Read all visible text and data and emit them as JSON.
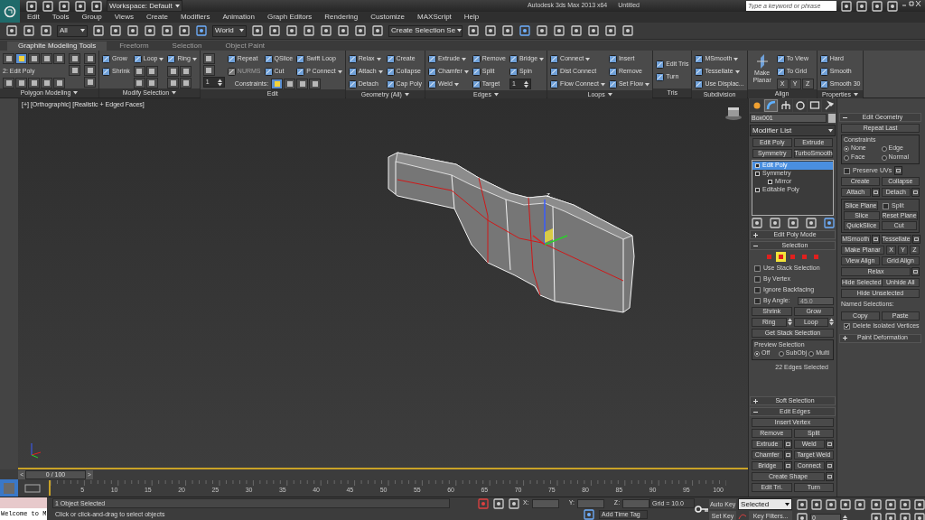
{
  "title_bar": {
    "workspace": "Workspace: Default",
    "title": "Autodesk 3ds Max 2013 x64",
    "document": "Untitled",
    "search": {
      "placeholder": "Type a keyword or phrase"
    }
  },
  "menu": [
    "Edit",
    "Tools",
    "Group",
    "Views",
    "Create",
    "Modifiers",
    "Animation",
    "Graph Editors",
    "Rendering",
    "Customize",
    "MAXScript",
    "Help"
  ],
  "toolbar": {
    "selection_filter": "All",
    "reference_coordinates": "World",
    "named_selection": "Create Selection Se"
  },
  "ribbon_tabs": [
    {
      "label": "Graphite Modeling Tools",
      "selected": true
    },
    {
      "label": "Freeform",
      "selected": false
    },
    {
      "label": "Selection",
      "selected": false
    },
    {
      "label": "Object Paint",
      "selected": false
    }
  ],
  "ribbon_groups": [
    {
      "title": "Polygon Modeling",
      "menu": true,
      "columns": [
        [
          {
            "kind": "subobjects",
            "items": [
              {
                "selected": false
              },
              {
                "selected": true
              },
              {
                "selected": false
              },
              {
                "selected": false
              },
              {
                "selected": false
              }
            ]
          },
          {
            "kind": "caption",
            "label": "2: Edit Poly"
          },
          {
            "kind": "tool-row"
          }
        ],
        [
          {
            "kind": "icon"
          },
          {
            "kind": "icon"
          }
        ],
        [
          {
            "kind": "icon"
          },
          {
            "kind": "icon"
          },
          {
            "kind": "icon"
          }
        ]
      ]
    },
    {
      "title": "Modify Selection",
      "menu": true,
      "columns": [
        [
          {
            "kind": "button",
            "label": "Grow"
          },
          {
            "kind": "button",
            "label": "Shrink"
          }
        ],
        [
          {
            "kind": "menu",
            "label": "Loop"
          },
          {
            "kind": "icon-pair"
          },
          {
            "kind": "icon-pair"
          }
        ],
        [
          {
            "kind": "menu",
            "label": "Ring"
          },
          {
            "kind": "icon-pair"
          },
          {
            "kind": "icon-pair"
          }
        ]
      ]
    },
    {
      "title": "Edit",
      "menu": false,
      "lead": [
        {
          "kind": "icon"
        },
        {
          "kind": "icon"
        },
        {
          "kind": "spinner",
          "value": "1"
        }
      ],
      "columns": [
        [
          {
            "kind": "button",
            "label": "Repeat"
          },
          {
            "kind": "button",
            "label": "NURMS",
            "disabled": true
          }
        ],
        [
          {
            "kind": "button",
            "label": "QSlice"
          },
          {
            "kind": "button",
            "label": "Cut"
          }
        ],
        [
          {
            "kind": "button",
            "label": "Swift Loop"
          },
          {
            "kind": "menu",
            "label": "P Connect"
          }
        ]
      ],
      "footer": {
        "label": "Constraints:",
        "items": [
          {
            "selected": true
          },
          {
            "selected": false
          },
          {
            "selected": false
          },
          {
            "selected": false
          }
        ]
      }
    },
    {
      "title": "Geometry (All)",
      "menu": true,
      "columns": [
        [
          {
            "kind": "menu",
            "label": "Relax"
          },
          {
            "kind": "menu",
            "label": "Attach"
          },
          {
            "kind": "button",
            "label": "Detach"
          }
        ],
        [
          {
            "kind": "button",
            "label": "Create"
          },
          {
            "kind": "button",
            "label": "Collapse"
          },
          {
            "kind": "button",
            "label": "Cap Poly"
          }
        ]
      ]
    },
    {
      "title": "Edges",
      "menu": true,
      "columns": [
        [
          {
            "kind": "menu",
            "label": "Extrude"
          },
          {
            "kind": "menu",
            "label": "Chamfer"
          },
          {
            "kind": "menu",
            "label": "Weld"
          }
        ],
        [
          {
            "kind": "button",
            "label": "Remove"
          },
          {
            "kind": "button",
            "label": "Split"
          },
          {
            "kind": "button",
            "label": "Target"
          }
        ],
        [
          {
            "kind": "menu",
            "label": "Bridge"
          },
          {
            "kind": "button",
            "label": "Spin"
          },
          {
            "kind": "spinner",
            "value": "1"
          }
        ]
      ]
    },
    {
      "title": "Loops",
      "menu": true,
      "columns": [
        [
          {
            "kind": "menu",
            "label": "Connect"
          },
          {
            "kind": "button",
            "label": "Dist Connect"
          },
          {
            "kind": "menu",
            "label": "Flow Connect"
          }
        ],
        [
          {
            "kind": "button",
            "label": "Insert"
          },
          {
            "kind": "button",
            "label": "Remove"
          },
          {
            "kind": "menu",
            "label": "Set  Flow"
          }
        ]
      ]
    },
    {
      "title": "Tris",
      "menu": false,
      "columns": [
        [
          {
            "kind": "button",
            "label": "Edit Tris"
          },
          {
            "kind": "button",
            "label": "Turn"
          }
        ]
      ]
    },
    {
      "title": "Subdivision",
      "menu": false,
      "columns": [
        [
          {
            "kind": "menu",
            "label": "MSmooth"
          },
          {
            "kind": "menu",
            "label": "Tessellate"
          },
          {
            "kind": "button",
            "label": "Use Displac..."
          }
        ]
      ]
    },
    {
      "title": "Align",
      "menu": false,
      "lead": [
        {
          "kind": "large",
          "label": "Make Planar"
        }
      ],
      "columns": [
        [
          {
            "kind": "button",
            "label": "To View"
          },
          {
            "kind": "button",
            "label": "To Grid"
          },
          {
            "kind": "axes",
            "labels": [
              "X",
              "Y",
              "Z"
            ]
          }
        ]
      ]
    },
    {
      "title": "Properties",
      "menu": true,
      "columns": [
        [
          {
            "kind": "button",
            "label": "Hard"
          },
          {
            "kind": "button",
            "label": "Smooth"
          },
          {
            "kind": "button",
            "label": "Smooth 30"
          }
        ]
      ]
    }
  ],
  "viewport": {
    "label": "[+] [Orthographic] [Realistic + Edged Faces]",
    "gizmo_axis": "z"
  },
  "command_panel": {
    "tabs": [
      {
        "kind": "create",
        "selected": false
      },
      {
        "kind": "modify",
        "selected": true
      },
      {
        "kind": "hierarchy",
        "selected": false
      },
      {
        "kind": "motion",
        "selected": false
      },
      {
        "kind": "display",
        "selected": false
      },
      {
        "kind": "utilities",
        "selected": false
      }
    ],
    "object_name": "Box001",
    "modifier_list": "Modifier List",
    "modifier_buttons": [
      "Edit Poly",
      "Extrude",
      "Symmetry",
      "TurboSmooth"
    ],
    "stack": [
      {
        "label": "Edit Poly",
        "selected": true
      },
      {
        "label": "Symmetry",
        "selected": false,
        "children": [
          {
            "label": "Mirror",
            "selected": false
          }
        ]
      },
      {
        "label": "Editable Poly",
        "selected": false
      }
    ],
    "rollouts": [
      {
        "title": "Edit Poly Mode",
        "expanded": false
      },
      {
        "title": "Selection",
        "expanded": true,
        "rows": [
          [
            {
              "kind": "subobjects",
              "items": [
                {
                  "selected": false
                },
                {
                  "selected": true
                },
                {
                  "selected": false
                },
                {
                  "selected": false
                },
                {
                  "selected": false
                }
              ]
            }
          ],
          [
            {
              "kind": "checkbox",
              "label": "Use Stack Selection",
              "checked": false
            }
          ],
          [
            {
              "kind": "checkbox",
              "label": "By Vertex",
              "checked": false
            }
          ],
          [
            {
              "kind": "checkbox",
              "label": "Ignore Backfacing",
              "checked": false
            }
          ],
          [
            {
              "kind": "checkbox",
              "label": "By Angle:",
              "checked": false
            },
            {
              "kind": "field",
              "value": "45.0"
            }
          ],
          [
            {
              "kind": "button",
              "label": "Shrink"
            },
            {
              "kind": "button",
              "label": "Grow"
            }
          ],
          [
            {
              "kind": "button",
              "label": "Ring",
              "spinner": true
            },
            {
              "kind": "button",
              "label": "Loop",
              "spinner": true
            }
          ],
          [
            {
              "kind": "button",
              "label": "Get Stack Selection"
            }
          ],
          [
            {
              "kind": "group",
              "title": "Preview Selection",
              "rows": [
                [
                  {
                    "kind": "radio",
                    "label": "Off",
                    "selected": true
                  },
                  {
                    "kind": "radio",
                    "label": "SubObj",
                    "selected": false
                  },
                  {
                    "kind": "radio",
                    "label": "Multi",
                    "selected": false
                  }
                ]
              ]
            }
          ],
          [
            {
              "kind": "text",
              "label": "22 Edges Selected"
            }
          ],
          [
            {
              "kind": "spacer"
            }
          ]
        ]
      },
      {
        "title": "Soft Selection",
        "expanded": false
      },
      {
        "title": "Edit Edges",
        "expanded": true,
        "rows": [
          [
            {
              "kind": "button",
              "label": "Insert Vertex"
            }
          ],
          [
            {
              "kind": "button",
              "label": "Remove"
            },
            {
              "kind": "button",
              "label": "Split"
            }
          ],
          [
            {
              "kind": "button",
              "label": "Extrude",
              "options": true
            },
            {
              "kind": "button",
              "label": "Weld",
              "options": true
            }
          ],
          [
            {
              "kind": "button",
              "label": "Chamfer",
              "options": true
            },
            {
              "kind": "button",
              "label": "Target Weld"
            }
          ],
          [
            {
              "kind": "button",
              "label": "Bridge",
              "options": true
            },
            {
              "kind": "button",
              "label": "Connect",
              "options": true
            }
          ],
          [
            {
              "kind": "button",
              "label": "Create Shape",
              "options": true
            }
          ],
          [
            {
              "kind": "button",
              "label": "Edit Tri."
            },
            {
              "kind": "button",
              "label": "Turn"
            }
          ]
        ]
      }
    ]
  },
  "geometry_panel": {
    "rollouts": [
      {
        "title": "Edit Geometry",
        "expanded": true,
        "rows": [
          [
            {
              "kind": "button",
              "label": "Repeat Last"
            }
          ],
          [
            {
              "kind": "group",
              "title": "Constraints",
              "rows": [
                [
                  {
                    "kind": "radio",
                    "label": "None",
                    "selected": true
                  },
                  {
                    "kind": "radio",
                    "label": "Edge",
                    "selected": false
                  }
                ],
                [
                  {
                    "kind": "radio",
                    "label": "Face",
                    "selected": false
                  },
                  {
                    "kind": "radio",
                    "label": "Normal",
                    "selected": false
                  }
                ]
              ]
            }
          ],
          [
            {
              "kind": "checkbox",
              "label": "Preserve UVs",
              "checked": false,
              "options": true
            }
          ],
          [
            {
              "kind": "button",
              "label": "Create"
            },
            {
              "kind": "button",
              "label": "Collapse"
            }
          ],
          [
            {
              "kind": "button",
              "label": "Attach",
              "options": true
            },
            {
              "kind": "button",
              "label": "Detach",
              "options": true
            }
          ],
          [
            {
              "kind": "group",
              "rows": [
                [
                  {
                    "kind": "button",
                    "label": "Slice Plane"
                  },
                  {
                    "kind": "checkbox",
                    "label": "Split",
                    "checked": false
                  }
                ],
                [
                  {
                    "kind": "button",
                    "label": "Slice"
                  },
                  {
                    "kind": "button",
                    "label": "Reset Plane"
                  }
                ],
                [
                  {
                    "kind": "button",
                    "label": "QuickSlice"
                  },
                  {
                    "kind": "button",
                    "label": "Cut"
                  }
                ]
              ]
            }
          ],
          [
            {
              "kind": "button",
              "label": "MSmooth",
              "options": true
            },
            {
              "kind": "button",
              "label": "Tessellate",
              "options": true
            }
          ],
          [
            {
              "kind": "button",
              "label": "Make Planar"
            },
            {
              "kind": "axis",
              "label": "X"
            },
            {
              "kind": "axis",
              "label": "Y"
            },
            {
              "kind": "axis",
              "label": "Z"
            }
          ],
          [
            {
              "kind": "button",
              "label": "View Align"
            },
            {
              "kind": "button",
              "label": "Grid Align"
            }
          ],
          [
            {
              "kind": "button",
              "label": "Relax",
              "options": true
            }
          ],
          [
            {
              "kind": "button",
              "label": "Hide Selected"
            },
            {
              "kind": "button",
              "label": "Unhide All"
            }
          ],
          [
            {
              "kind": "button",
              "label": "Hide Unselected"
            }
          ],
          [
            {
              "kind": "text-left",
              "label": "Named Selections:"
            }
          ],
          [
            {
              "kind": "button",
              "label": "Copy"
            },
            {
              "kind": "button",
              "label": "Paste"
            }
          ],
          [
            {
              "kind": "checkbox",
              "label": "Delete Isolated Vertices",
              "checked": true
            }
          ]
        ]
      },
      {
        "title": "Paint Deformation",
        "expanded": false
      }
    ]
  },
  "timeline": {
    "frame": "0 / 100",
    "prev": "<",
    "next": ">",
    "ticks": [
      "5",
      "10",
      "15",
      "20",
      "25",
      "30",
      "35",
      "40",
      "45",
      "50",
      "55",
      "60",
      "65",
      "70",
      "75",
      "80",
      "85",
      "90",
      "95",
      "100"
    ]
  },
  "status_bar": {
    "listener": "Welcome to M",
    "selection": "1 Object Selected",
    "prompt": "Click or click-and-drag to select objects",
    "x_label": "X:",
    "y_label": "Y:",
    "z_label": "Z:",
    "grid": "Grid = 10.0",
    "time_tag": "Add Time Tag",
    "auto_key": "Auto Key",
    "set_key": "Set Key",
    "key_mode": "Selected",
    "key_filters": "Key Filters...",
    "current_frame": "0"
  }
}
